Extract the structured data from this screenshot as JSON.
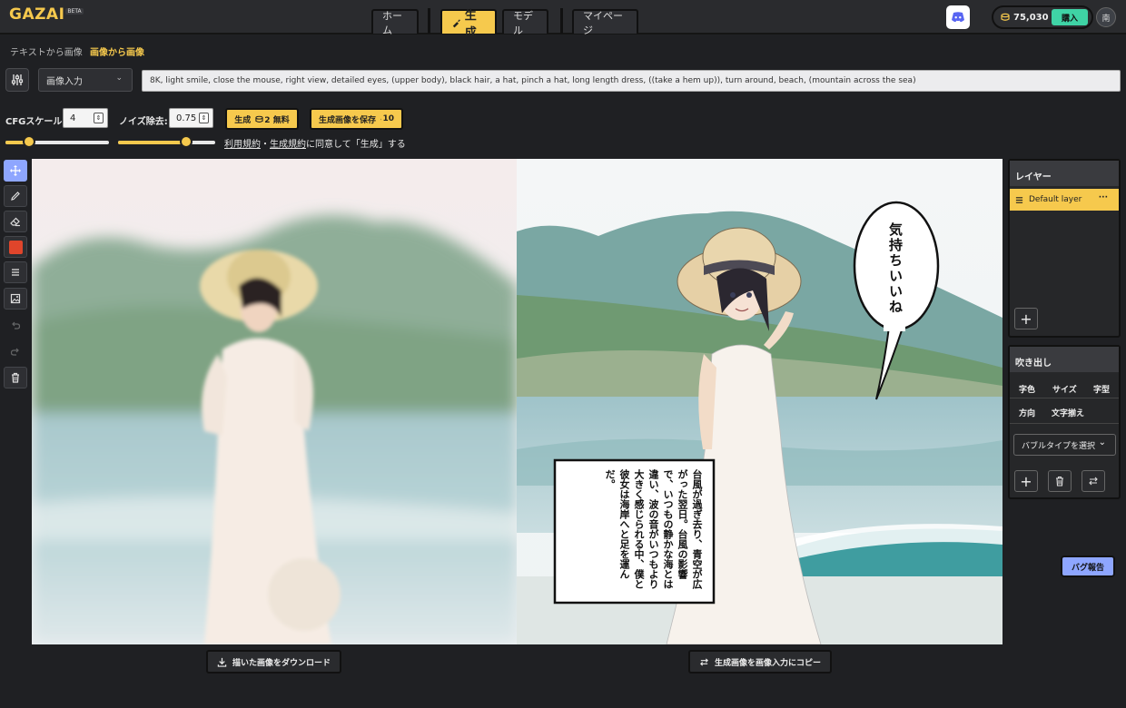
{
  "app": {
    "logo": "GAZAI",
    "logo_badge": "BETA"
  },
  "nav": {
    "home": "ホーム",
    "generate": "生成",
    "model": "モデル",
    "mypage": "マイページ"
  },
  "account": {
    "credits": "75,030",
    "buy": "購入",
    "avatar": "南"
  },
  "subtabs": {
    "text2img": "テキストから画像",
    "img2img": "画像から画像"
  },
  "controls": {
    "input_mode": "画像入力",
    "prompt": "8K, light smile, close the mouse, right view, detailed eyes, (upper body), black hair, a hat, pinch a hat, long length dress, ((take a hem up)), turn around, beach, (mountain across the sea)",
    "cfg_label": "CFGスケール:",
    "cfg_value": "4",
    "denoise_label": "ノイズ除去:",
    "denoise_value": "0.75",
    "generate_btn": "生成",
    "generate_cost": "2 無料",
    "save_btn": "生成画像を保存",
    "save_cost": "10",
    "cfg_slider_fraction": 0.23,
    "denoise_slider_fraction": 0.7
  },
  "terms": {
    "tos": "利用規約",
    "sep": "・",
    "gen_terms": "生成規約",
    "suffix": "に同意して「生成」する"
  },
  "canvas": {
    "bubble_text": "気持ちいいね",
    "narration": "台風が過ぎ去り、青空が広がった翌日。台風の影響で、いつもの静かな海とは違い、波の音がいつもより大きく感じられる中、僕と彼女は海岸へと足を運んだ。"
  },
  "bottom": {
    "download": "描いた画像をダウンロード",
    "copy": "生成画像を画像入力にコピー"
  },
  "layers": {
    "title": "レイヤー",
    "default_layer": "Default layer",
    "menu": "···"
  },
  "bubbles": {
    "title": "吹き出し",
    "options": [
      "字色",
      "サイズ",
      "字型",
      "方向",
      "文字揃え"
    ],
    "type_select": "バブルタイプを選択"
  },
  "bug_report": "バグ報告",
  "colors": {
    "accent": "#f6c94d",
    "blue": "#8ea6ff",
    "green": "#3fd3a5",
    "brush": "#e0452b"
  },
  "icons": [
    "sliders-icon",
    "move-icon",
    "pencil-icon",
    "eraser-icon",
    "color-swatch-icon",
    "layers-menu-icon",
    "image-icon",
    "undo-icon",
    "redo-icon",
    "trash-icon",
    "discord-icon",
    "coin-icon",
    "download-icon",
    "swap-icon",
    "plus-icon"
  ]
}
